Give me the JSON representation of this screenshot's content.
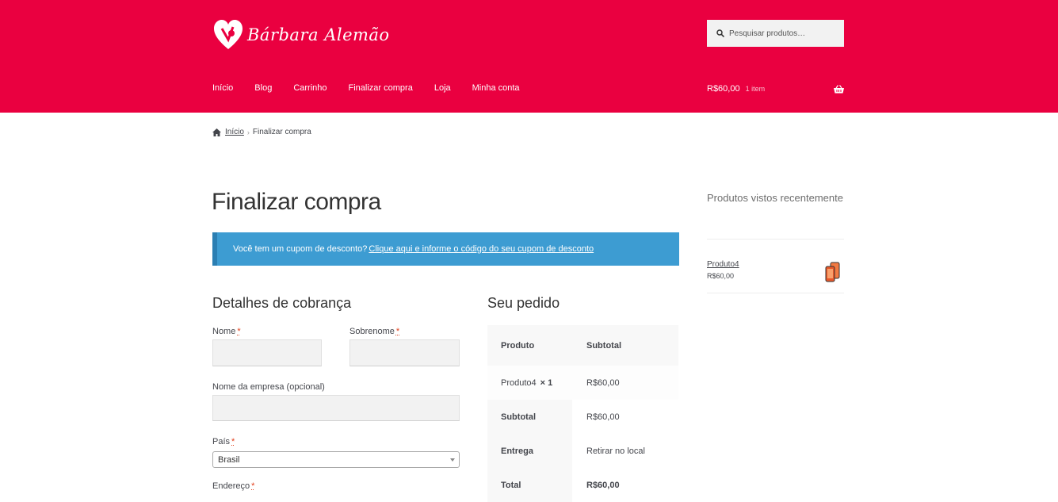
{
  "brand": {
    "name": "Bárbara Alemão",
    "header_color": "#ea0040"
  },
  "search": {
    "placeholder": "Pesquisar produtos…",
    "icon": "search-icon"
  },
  "nav": {
    "items": [
      "Início",
      "Blog",
      "Carrinho",
      "Finalizar compra",
      "Loja",
      "Minha conta"
    ]
  },
  "cart": {
    "total": "R$60,00",
    "count": "1 item",
    "icon": "basket-icon"
  },
  "breadcrumb": {
    "home": "Início",
    "current": "Finalizar compra"
  },
  "page": {
    "title": "Finalizar compra"
  },
  "notice": {
    "text": "Você tem um cupom de desconto?",
    "link": "Clique aqui e informe o código do seu cupom de desconto",
    "color": "#3d9cd2"
  },
  "billing": {
    "heading": "Detalhes de cobrança",
    "first_name_label": "Nome",
    "last_name_label": "Sobrenome",
    "company_label": "Nome da empresa (opcional)",
    "country_label": "País",
    "country_value": "Brasil",
    "address_label": "Endereço",
    "required_mark": "*"
  },
  "order": {
    "heading": "Seu pedido",
    "col_product": "Produto",
    "col_subtotal": "Subtotal",
    "item_name": "Produto4",
    "item_qty": "× 1",
    "item_price": "R$60,00",
    "subtotal_label": "Subtotal",
    "subtotal_value": "R$60,00",
    "shipping_label": "Entrega",
    "shipping_value": "Retirar no local",
    "total_label": "Total",
    "total_value": "R$60,00"
  },
  "sidebar": {
    "title": "Produtos vistos recentemente",
    "product_name": "Produto4",
    "product_price": "R$60,00"
  }
}
